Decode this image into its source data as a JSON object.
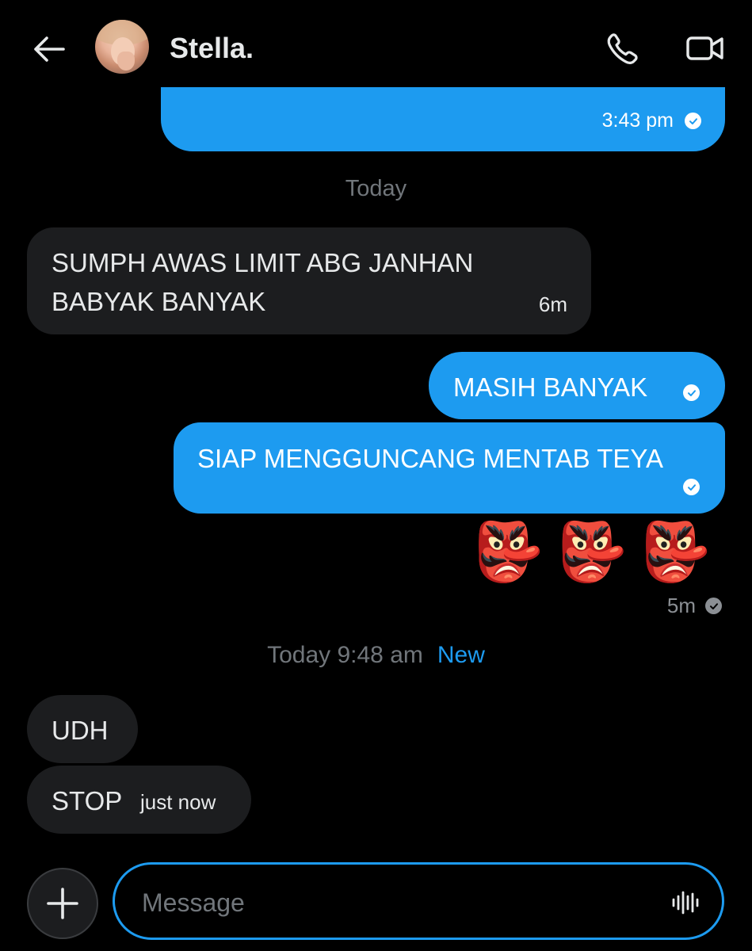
{
  "header": {
    "contact_name": "Stella.",
    "icons": {
      "back": "arrow-left-icon",
      "call": "phone-icon",
      "video": "video-camera-icon"
    }
  },
  "colors": {
    "background": "#000000",
    "outgoing_bubble": "#1d9bf0",
    "incoming_bubble": "#1c1d1f",
    "accent": "#1d9bf0"
  },
  "messages": {
    "m1_time": "3:43 pm",
    "divider_today": "Today",
    "m2_text": "SUMPH AWAS LIMIT ABG JANHAN BABYAK BANYAK",
    "m2_time": "6m",
    "m3_text": "MASIH BANYAK",
    "m4_text": "SIAP MENGGUNCANG MENTAB TEYA",
    "m5_emoji": "👺👺👺",
    "m5_time": "5m",
    "divider_new_time": "Today 9:48 am",
    "divider_new_label": "New",
    "m6_text": "UDH",
    "m7_text": "STOP",
    "m7_time": "just now"
  },
  "composer": {
    "placeholder": "Message",
    "value": "",
    "icons": {
      "add": "plus-icon",
      "voice": "voice-waveform-icon"
    }
  }
}
